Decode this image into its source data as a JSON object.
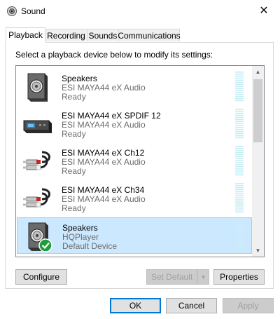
{
  "window": {
    "title": "Sound",
    "app_icon": "speaker-icon",
    "close_glyph": "✕"
  },
  "tabs": [
    {
      "label": "Playback"
    },
    {
      "label": "Recording"
    },
    {
      "label": "Sounds"
    },
    {
      "label": "Communications"
    }
  ],
  "active_tab": "Playback",
  "instruction": "Select a playback device below to modify its settings:",
  "devices": [
    {
      "name": "Speakers",
      "driver": "ESI MAYA44 eX Audio",
      "status": "Ready",
      "icon": "speaker-box-icon",
      "selected": false
    },
    {
      "name": "ESI MAYA44 eX SPDIF 12",
      "driver": "ESI MAYA44 eX Audio",
      "status": "Ready",
      "icon": "spdif-device-icon",
      "selected": false
    },
    {
      "name": "ESI MAYA44 eX Ch12",
      "driver": "ESI MAYA44 eX Audio",
      "status": "Ready",
      "icon": "rca-cable-icon",
      "selected": false
    },
    {
      "name": "ESI MAYA44 eX Ch34",
      "driver": "ESI MAYA44 eX Audio",
      "status": "Ready",
      "icon": "rca-cable-icon",
      "selected": false
    },
    {
      "name": "Speakers",
      "driver": "HQPlayer",
      "status": "Default Device",
      "icon": "speaker-box-icon",
      "selected": true,
      "badge": "default-check-icon"
    }
  ],
  "buttons": {
    "configure": "Configure",
    "set_default": "Set Default",
    "properties": "Properties",
    "ok": "OK",
    "cancel": "Cancel",
    "apply": "Apply"
  },
  "colors": {
    "selection_bg": "#cce8ff",
    "selection_border": "#99d1ff",
    "accent": "#0078d7",
    "meter": "#c8eef5",
    "check_badge": "#1e9e3a"
  }
}
